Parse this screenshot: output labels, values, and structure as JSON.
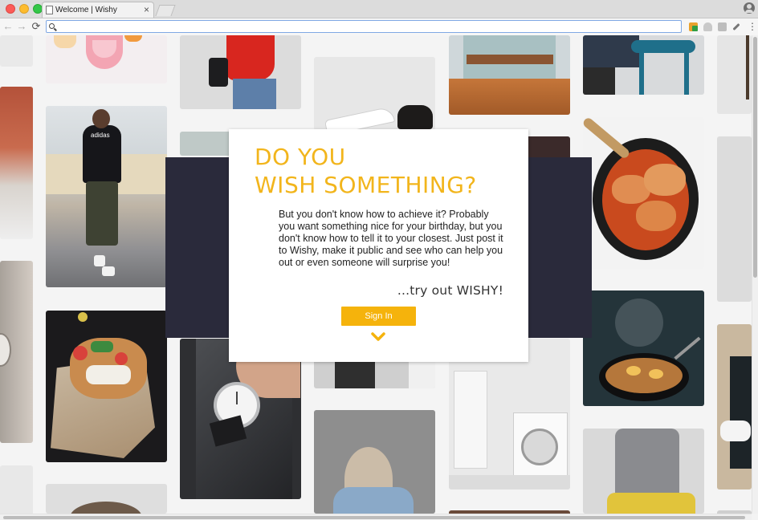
{
  "browser": {
    "tab_title": "Welcome | Wishy",
    "tab_close": "×",
    "address_value": "",
    "nav": {
      "back": "←",
      "forward": "→",
      "reload": "⟳"
    },
    "menu": "⋮"
  },
  "modal": {
    "headline_line1": "DO YOU",
    "headline_line2": "WISH SOMETHING?",
    "body": "But you don't know how to achieve it? Probably you want something nice for your birthday, but you don't know how to tell it to your closest. Just post it to Wishy, make it public and see who can help you out or even someone will surprise you!",
    "tagline": "...try out WISHY!",
    "signin_label": "Sign In"
  },
  "gallery": {
    "tile_subjects": [
      "smoothie-drinks",
      "person-red-jacket",
      "white-sneakers",
      "wooden-shelves",
      "blue-chair",
      "brick-wall",
      "man-adidas-hoodie",
      "food-wrap",
      "food-tacos",
      "wrist-watch",
      "skillet-chicken",
      "ramen-bowl",
      "hooded-person",
      "white-kitchen",
      "grey-sweatpants",
      "white-room",
      "plant-room"
    ],
    "colors": {
      "accent": "#f2b51c",
      "band": "#2a2a3b",
      "button": "#f5b30c"
    }
  }
}
